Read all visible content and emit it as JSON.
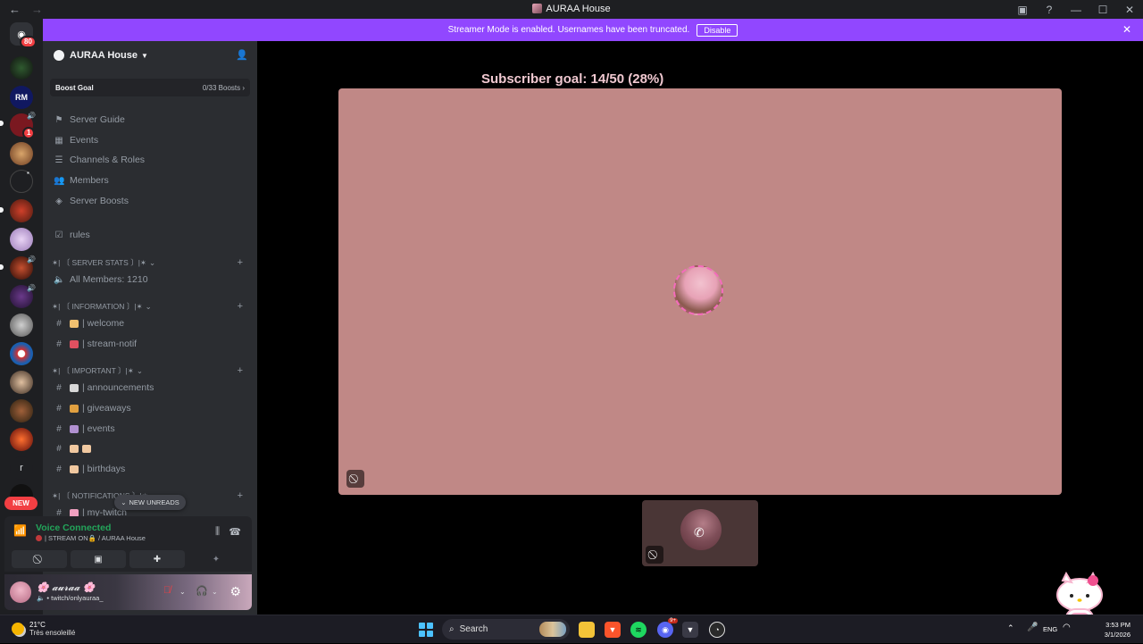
{
  "window": {
    "title": "AURAA House",
    "back_icon": "←",
    "forward_icon": "→"
  },
  "rail": {
    "dm_badge": "80",
    "server_badge": "1",
    "new_label": "NEW",
    "letter_server": "r"
  },
  "streamer_bar": {
    "message": "Streamer Mode is enabled. Usernames have been truncated.",
    "disable_label": "Disable"
  },
  "server": {
    "name": "AURAA House",
    "boost_goal_label": "Boost Goal",
    "boost_count": "0/33 Boosts ›"
  },
  "nav_items": [
    {
      "label": "Server Guide"
    },
    {
      "label": "Events"
    },
    {
      "label": "Channels & Roles"
    },
    {
      "label": "Members"
    },
    {
      "label": "Server Boosts"
    }
  ],
  "channels": {
    "rules": "rules",
    "cat_server_stats": "✶| 〔 SERVER STATS 〕|✶",
    "all_members": "All Members: 1210",
    "cat_information": "✶| 〔 INFORMATION 〕|✶",
    "welcome": "| welcome",
    "stream_notif": "| stream-notif",
    "cat_important": "✶| 〔 IMPORTANT 〕|✶",
    "announcements": "| announcements",
    "giveaways": "| giveaways",
    "events": "| events",
    "birthdays": "| birthdays",
    "cat_notifications": "✶| 〔 NOTIFICATIONS 〕|✶",
    "my_twitch": "| my-twitch"
  },
  "new_unreads": "NEW UNREADS",
  "voice": {
    "status": "Voice Connected",
    "channel": "| STREAM ON🔒 / AURAA House"
  },
  "user": {
    "name": "🌸 𝓪𝓾𝓻𝓪𝓪 🌸",
    "status": "twitch/onlyauraa_"
  },
  "stage": {
    "goal_text": "Subscriber goal: 14/50 (28%)"
  },
  "taskbar": {
    "temp": "21°C",
    "weather": "Très ensoleillé",
    "search": "Search",
    "discord_badge": "9+",
    "lang": "ENG",
    "time": "3:53 PM",
    "date": "3/1/2026"
  },
  "colors": {
    "streamer_bar": "#9147ff",
    "stage_bg": "#c08886",
    "voice_connected": "#23a55a",
    "badge_red": "#f23f43"
  }
}
